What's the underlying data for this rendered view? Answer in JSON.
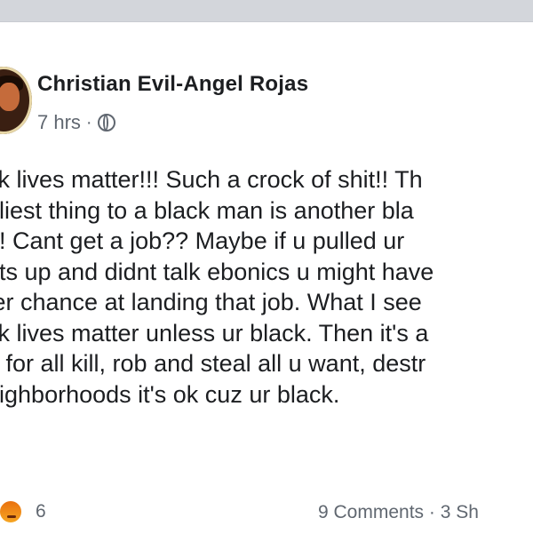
{
  "post": {
    "author_name": "Christian Evil-Angel Rojas",
    "timestamp": "7 hrs",
    "separator": "·",
    "privacy_icon": "globe-icon",
    "lines": [
      "ck lives matter!!! Such a crock of shit!! Th",
      "dliest thing to a black man is another bla",
      "n! Cant get a job?? Maybe if u pulled ur",
      "nts up and didnt talk ebonics u might have",
      "ter chance at landing that job. What I see",
      "ck lives matter unless ur black. Then it's a",
      "e for all kill, rob and steal all u want, destr",
      "eighborhoods it's ok cuz ur black."
    ]
  },
  "footer": {
    "reaction_icons": [
      "wow-reaction-icon",
      "angry-reaction-icon"
    ],
    "reaction_count": "6",
    "comments_text": "9 Comments · 3 Sh"
  }
}
